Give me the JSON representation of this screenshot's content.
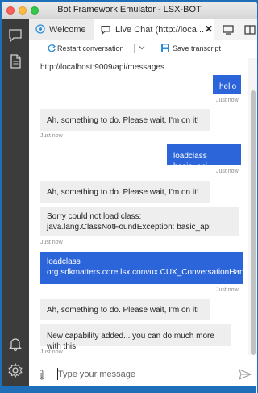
{
  "window": {
    "title": "Bot Framework Emulator - LSX-BOT"
  },
  "activity_bar": {
    "top_icons": [
      "chat-icon",
      "document-icon"
    ],
    "bottom_icons": [
      "bell-icon",
      "gear-icon"
    ]
  },
  "tabs": [
    {
      "label": "Welcome",
      "icon": "globe-icon"
    },
    {
      "label": "Live Chat (http://loca...",
      "icon": "chat-bubble-icon",
      "close": "✕",
      "active": true
    }
  ],
  "toolbar": {
    "restart_label": "Restart conversation",
    "save_label": "Save transcript"
  },
  "endpoint": "http://localhost:9009/api/messages",
  "messages": [
    {
      "from": "user",
      "text": "hello",
      "time": "Just now"
    },
    {
      "from": "bot",
      "text": "Ah, something to do. Please wait, I'm on it!",
      "time": "Just now"
    },
    {
      "from": "user",
      "text": "loadclass basic_api",
      "time": "Just now"
    },
    {
      "from": "bot",
      "text": "Ah, something to do. Please wait, I'm on it!",
      "time": ""
    },
    {
      "from": "bot",
      "text": "Sorry could not load class: java.lang.ClassNotFoundException: basic_api",
      "time": "Just now"
    },
    {
      "from": "user",
      "text": "loadclass org.sdkmatters.core.lsx.convux.CUX_ConversationHandler",
      "time": "Just now"
    },
    {
      "from": "bot",
      "text": "Ah, something to do. Please wait, I'm on it!",
      "time": ""
    },
    {
      "from": "bot",
      "text": "New capability added... you can do much more with this",
      "time": "Just now"
    }
  ],
  "input": {
    "placeholder": "Type your message"
  },
  "colors": {
    "user_bubble": "#2b65d9",
    "bot_bubble": "#eeeeee",
    "activity_bar": "#3c3c3c"
  }
}
